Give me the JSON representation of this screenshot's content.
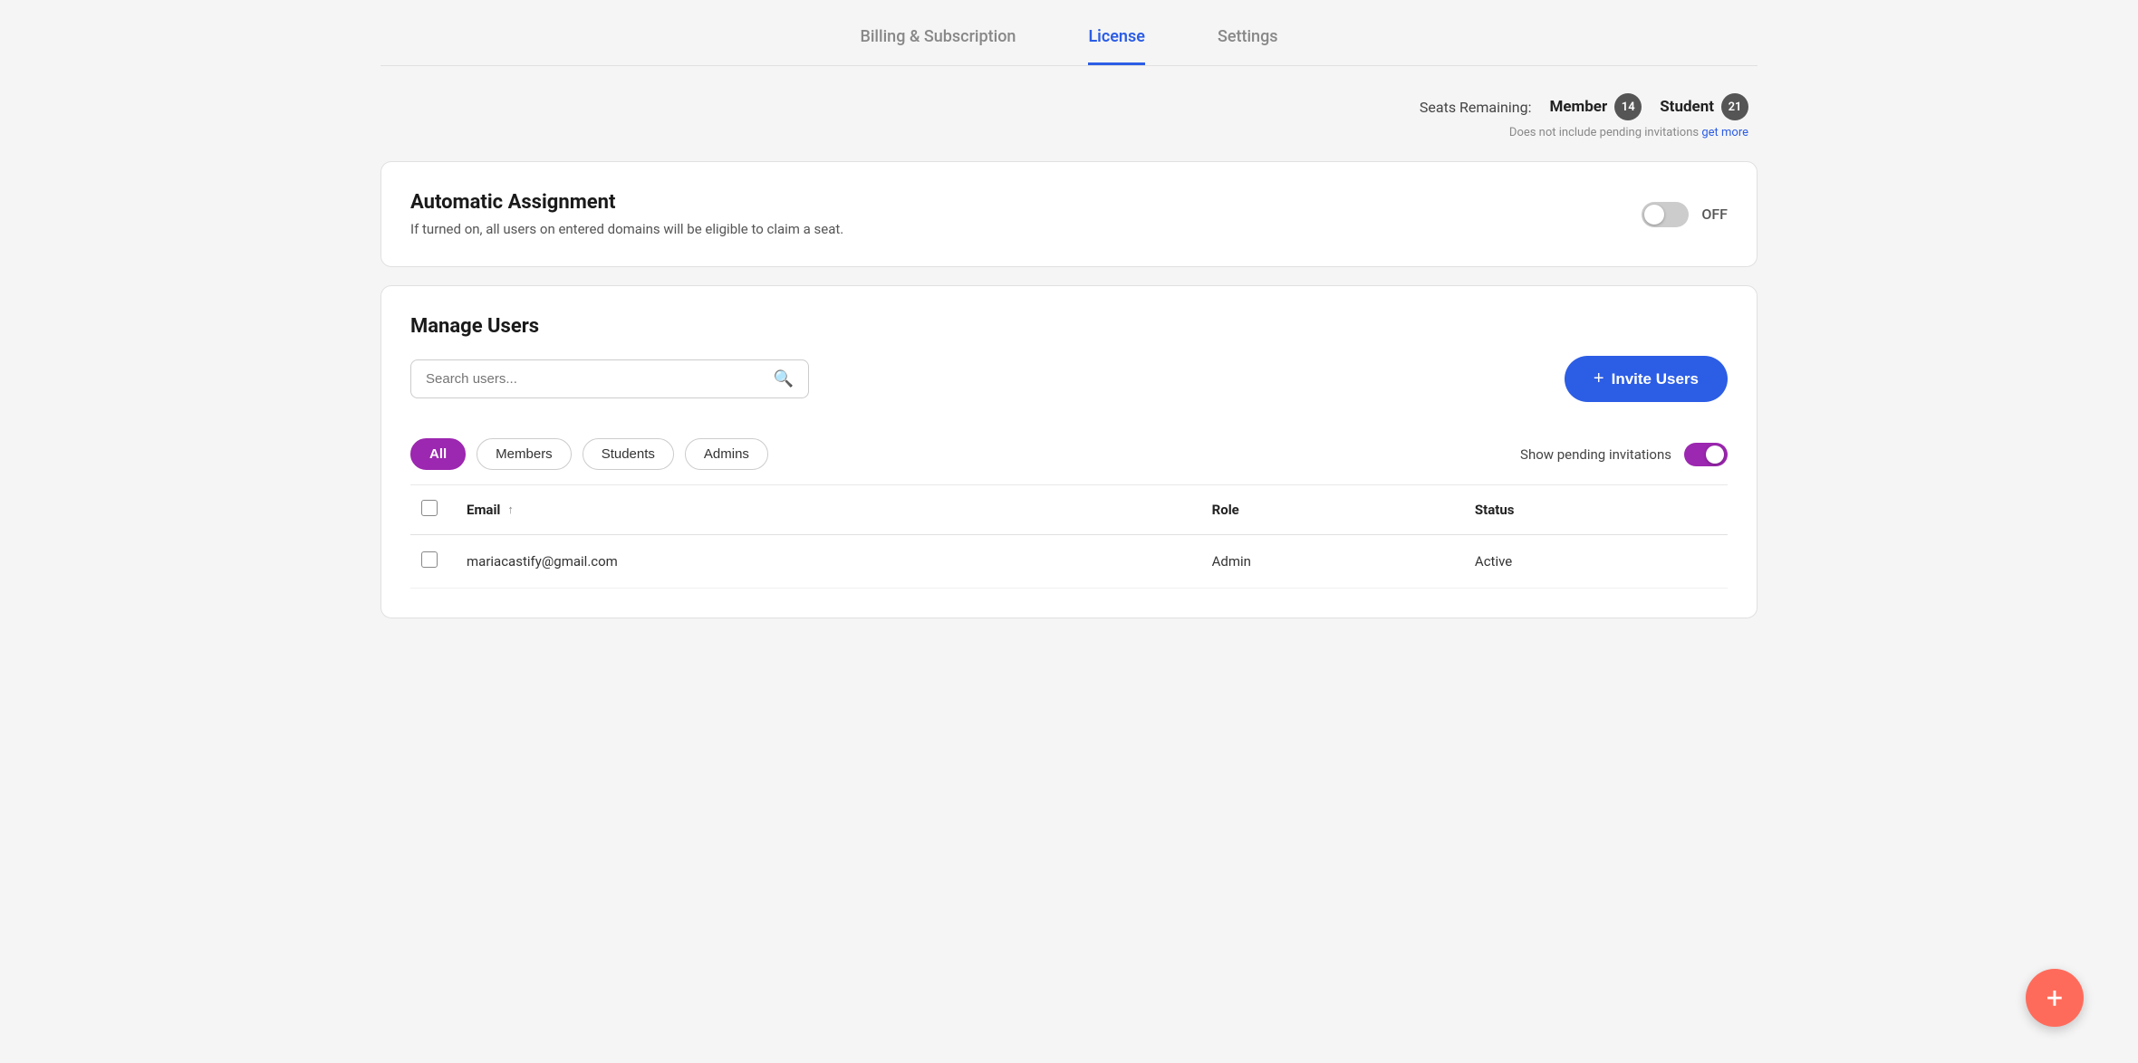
{
  "tabs": [
    {
      "id": "billing",
      "label": "Billing & Subscription",
      "active": false
    },
    {
      "id": "license",
      "label": "License",
      "active": true
    },
    {
      "id": "settings",
      "label": "Settings",
      "active": false
    }
  ],
  "seats": {
    "label": "Seats Remaining:",
    "member": {
      "label": "Member",
      "count": "14"
    },
    "student": {
      "label": "Student",
      "count": "21"
    },
    "note": "Does not include pending invitations",
    "get_more_label": "get more"
  },
  "auto_assignment": {
    "title": "Automatic Assignment",
    "description": "If turned on, all users on entered domains will be eligible to claim a seat.",
    "toggle_state": "OFF"
  },
  "manage_users": {
    "title": "Manage Users",
    "search_placeholder": "Search users...",
    "invite_button": "Invite Users",
    "filter_tabs": [
      {
        "id": "all",
        "label": "All",
        "active": true
      },
      {
        "id": "members",
        "label": "Members",
        "active": false
      },
      {
        "id": "students",
        "label": "Students",
        "active": false
      },
      {
        "id": "admins",
        "label": "Admins",
        "active": false
      }
    ],
    "show_pending_label": "Show pending invitations",
    "table": {
      "columns": [
        {
          "id": "checkbox",
          "label": ""
        },
        {
          "id": "email",
          "label": "Email",
          "sortable": true
        },
        {
          "id": "role",
          "label": "Role"
        },
        {
          "id": "status",
          "label": "Status"
        }
      ],
      "rows": [
        {
          "email": "mariacastify@gmail.com",
          "role": "Admin",
          "status": "Active"
        }
      ]
    }
  },
  "fab": {
    "icon": "+"
  }
}
